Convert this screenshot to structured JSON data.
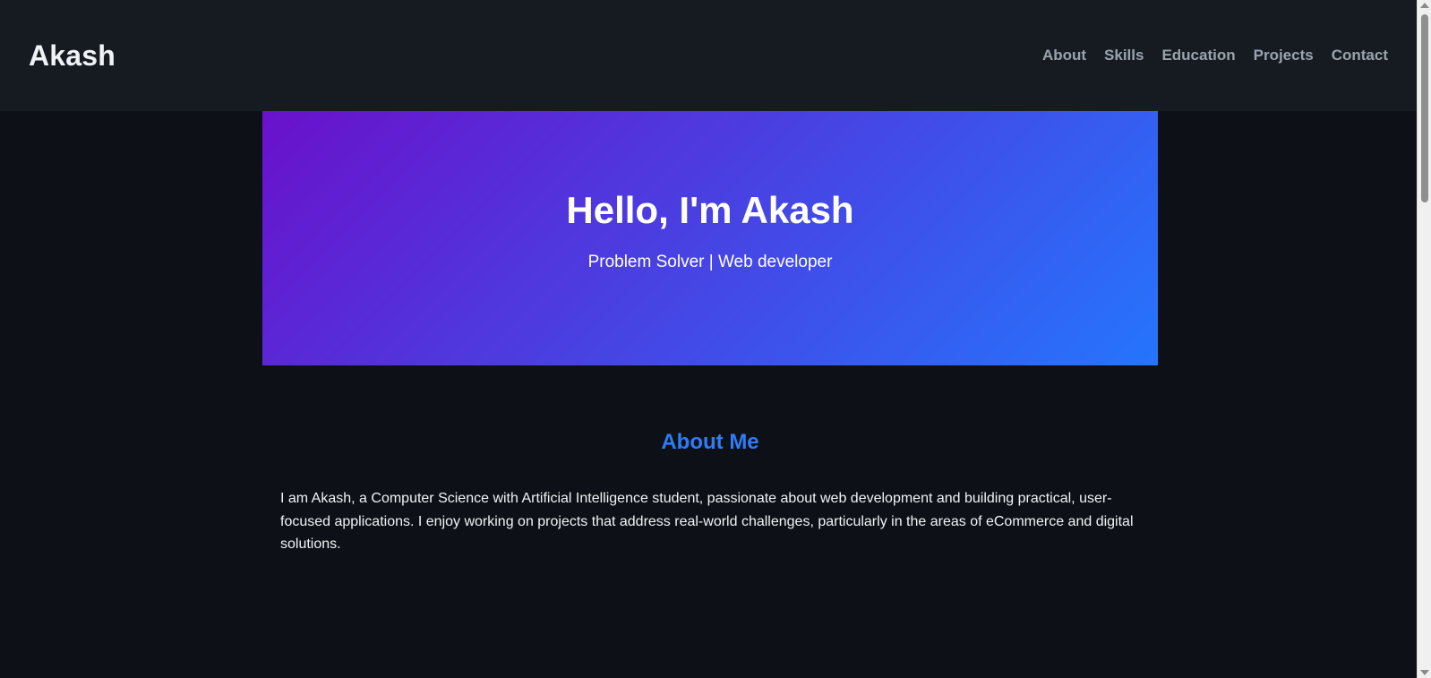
{
  "header": {
    "brand": "Akash",
    "nav": [
      {
        "label": "About"
      },
      {
        "label": "Skills"
      },
      {
        "label": "Education"
      },
      {
        "label": "Projects"
      },
      {
        "label": "Contact"
      }
    ]
  },
  "hero": {
    "title": "Hello, I'm Akash",
    "subtitle": "Problem Solver | Web developer"
  },
  "about": {
    "title": "About Me",
    "text": "I am Akash, a Computer Science with Artificial Intelligence student, passionate about web development and building practical, user-focused applications. I enjoy working on projects that address real-world challenges, particularly in the areas of eCommerce and digital solutions."
  },
  "colors": {
    "background": "#0d1117",
    "header_bg": "#161b22",
    "gradient_start": "#6a11cb",
    "gradient_end": "#2575fc",
    "accent": "#2f7cf6"
  }
}
